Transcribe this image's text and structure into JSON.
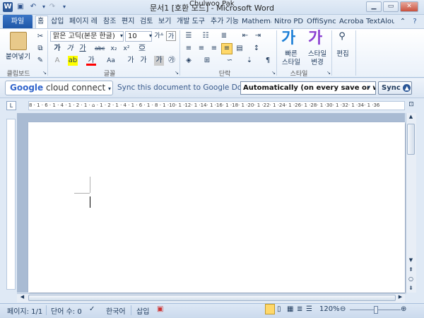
{
  "window": {
    "title": "문서1 [호환 모드] - Microsoft Word",
    "user": "Chulwoo Pak"
  },
  "tabs": {
    "file": "파일",
    "items": [
      "홈",
      "삽입",
      "페이지 레",
      "참조",
      "편지",
      "검토",
      "보기",
      "개발 도구",
      "추가 기능",
      "Mathema",
      "Nitro PDI",
      "OffiSync",
      "Acrobat",
      "TextAlou"
    ]
  },
  "ribbon": {
    "clipboard": {
      "paste": "붙여넣기",
      "label": "클립보드"
    },
    "font": {
      "name": "맑은 고딕(본문 한글)",
      "size": "10",
      "label": "글꼴"
    },
    "paragraph": {
      "label": "단락"
    },
    "styles": {
      "quick": "빠른 스타일",
      "quick_line1": "빠른",
      "quick_line2": "스타일",
      "change": "스타일 변경",
      "change_line1": "스타일",
      "change_line2": "변경",
      "label": "스타일"
    },
    "editing": {
      "label": "편집"
    }
  },
  "google_bar": {
    "brand": "Google",
    "connect": "cloud connect",
    "sync_text": "Sync this document to Google Docs",
    "mode": "Automatically (on every save or whe",
    "sync_button": "Sync"
  },
  "ruler": {
    "ticks": "8 · 1 · 6 · 1 · 4 · 1 · 2 · 1 · ⌂ · 1 · 2 · 1 · 4 · 1 · 6 · 1 · 8 · 1 ·10· 1 ·12· 1 ·14· 1 ·16· 1 ·18· 1 ·20· 1 ·22· 1 ·24· 1 ·26· 1 ·28· 1 ·30· 1 ·32· 1 ·34· 1 ·36"
  },
  "status": {
    "page": "페이지: 1/1",
    "words": "단어 수: 0",
    "language": "한국어",
    "insert": "삽입",
    "zoom": "120%"
  },
  "colors": {
    "file_tab": "#1f57a8",
    "highlight_yellow": "#ffff00",
    "font_red": "#ff0000"
  }
}
